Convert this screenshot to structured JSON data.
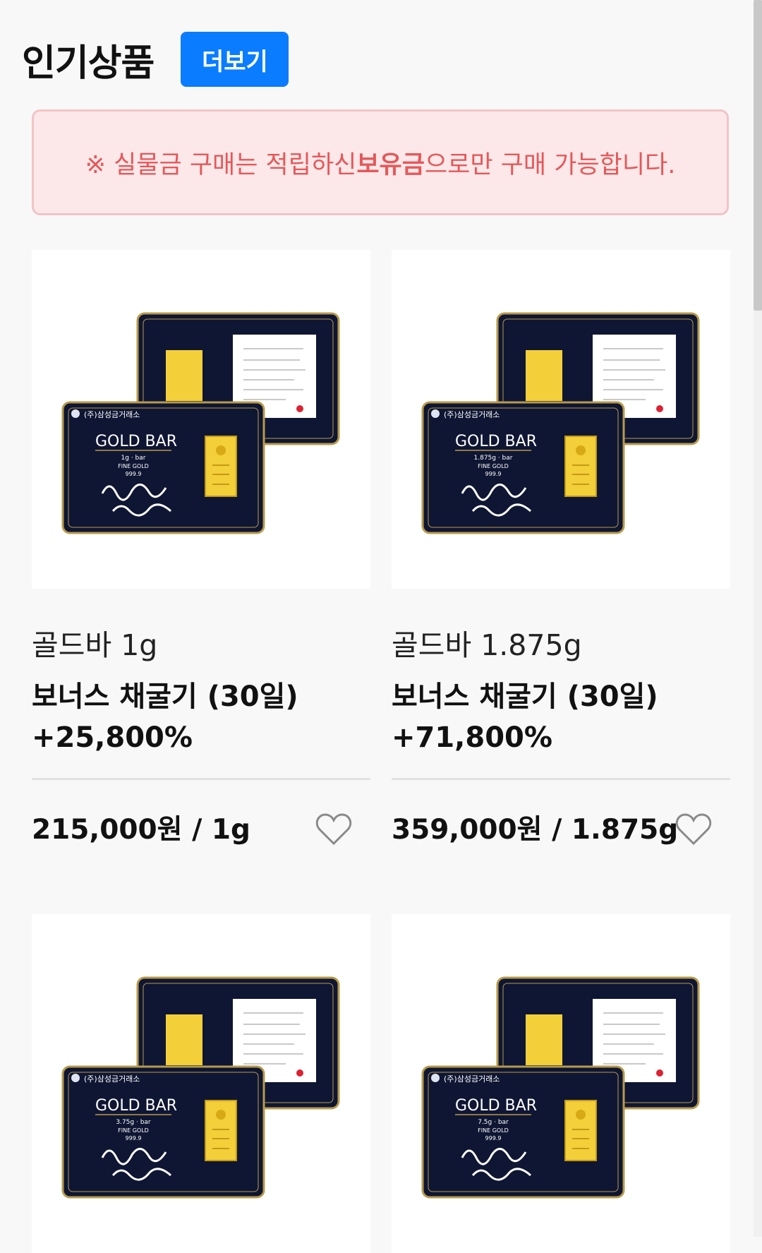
{
  "header": {
    "title": "인기상품",
    "more_label": "더보기"
  },
  "notice": {
    "prefix": "※ 실물금 구매는 적립하신 ",
    "bold": "보유금",
    "suffix": "으로만 구매 가능합니다."
  },
  "products": [
    {
      "name": "골드바 1g",
      "bonus_line1": "보너스 채굴기 (30일)",
      "bonus_line2": "+25,800%",
      "price": "215,000원 / 1g",
      "card_brand": "(주)삼성금거래소",
      "card_title": "GOLD BAR",
      "card_weight": "1g · bar",
      "card_fine": "FINE GOLD",
      "card_purity": "999.9"
    },
    {
      "name": "골드바 1.875g",
      "bonus_line1": "보너스 채굴기 (30일)",
      "bonus_line2": "+71,800%",
      "price": "359,000원 / 1.875g",
      "card_brand": "(주)삼성금거래소",
      "card_title": "GOLD BAR",
      "card_weight": "1.875g · bar",
      "card_fine": "FINE GOLD",
      "card_purity": "999.9"
    },
    {
      "card_brand": "(주)삼성금거래소",
      "card_title": "GOLD BAR",
      "card_weight": "3.75g · bar",
      "card_fine": "FINE GOLD",
      "card_purity": "999.9"
    },
    {
      "card_brand": "(주)삼성금거래소",
      "card_title": "GOLD BAR",
      "card_weight": "7.5g · bar",
      "card_fine": "FINE GOLD",
      "card_purity": "999.9"
    }
  ],
  "colors": {
    "accent": "#0a7cff",
    "notice_text": "#e5585a",
    "notice_bg": "#fde8e9",
    "card_navy": "#0e1633",
    "gold": "#f3cf3a"
  }
}
